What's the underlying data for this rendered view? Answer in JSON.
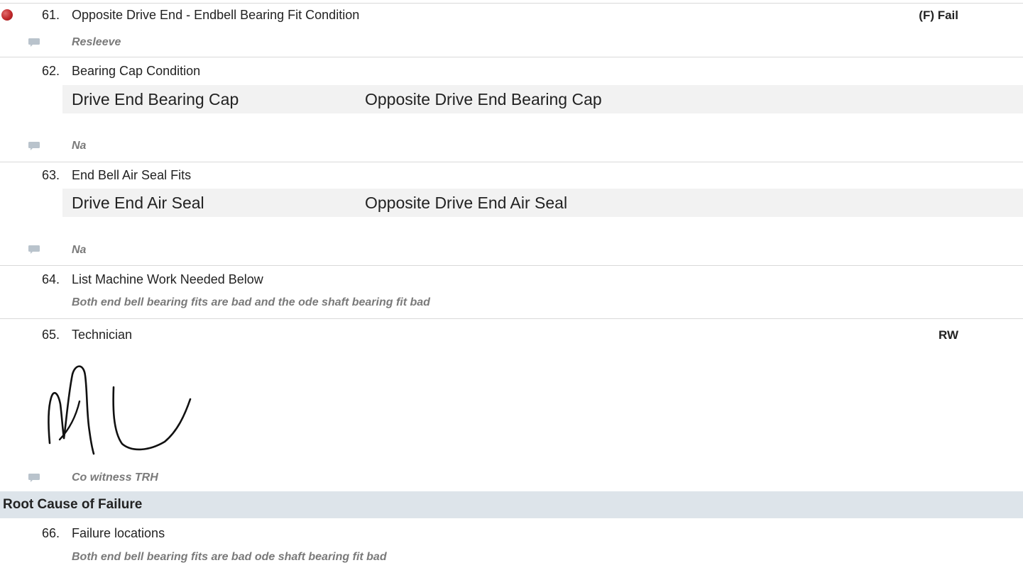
{
  "items": [
    {
      "number": "61.",
      "label": "Opposite Drive End - Endbell Bearing Fit Condition",
      "result": "(F) Fail",
      "status": "fail",
      "note": "Resleeve"
    },
    {
      "number": "62.",
      "label": "Bearing Cap Condition",
      "columns": [
        "Drive End Bearing Cap",
        "Opposite Drive End Bearing Cap"
      ],
      "note": "Na"
    },
    {
      "number": "63.",
      "label": "End Bell Air Seal Fits",
      "columns": [
        "Drive End Air Seal",
        "Opposite Drive End Air Seal"
      ],
      "note": "Na"
    },
    {
      "number": "64.",
      "label": "List Machine Work Needed Below",
      "note": "Both end bell bearing fits are bad and the ode shaft bearing fit bad"
    },
    {
      "number": "65.",
      "label": "Technician",
      "result": "RW",
      "signature": "RW",
      "note": "Co witness TRH"
    }
  ],
  "section": {
    "title": "Root Cause of Failure",
    "items": [
      {
        "number": "66.",
        "label": "Failure locations",
        "note": "Both end bell bearing fits are bad ode shaft bearing fit bad"
      }
    ]
  },
  "colors": {
    "fail": "#c0282a",
    "section_bg": "#dde4ea",
    "note": "#7a7a7a",
    "comment_icon": "#b9c3cc"
  },
  "icons": {
    "fail_indicator": "fail-dot-icon",
    "comment": "comment-icon"
  }
}
